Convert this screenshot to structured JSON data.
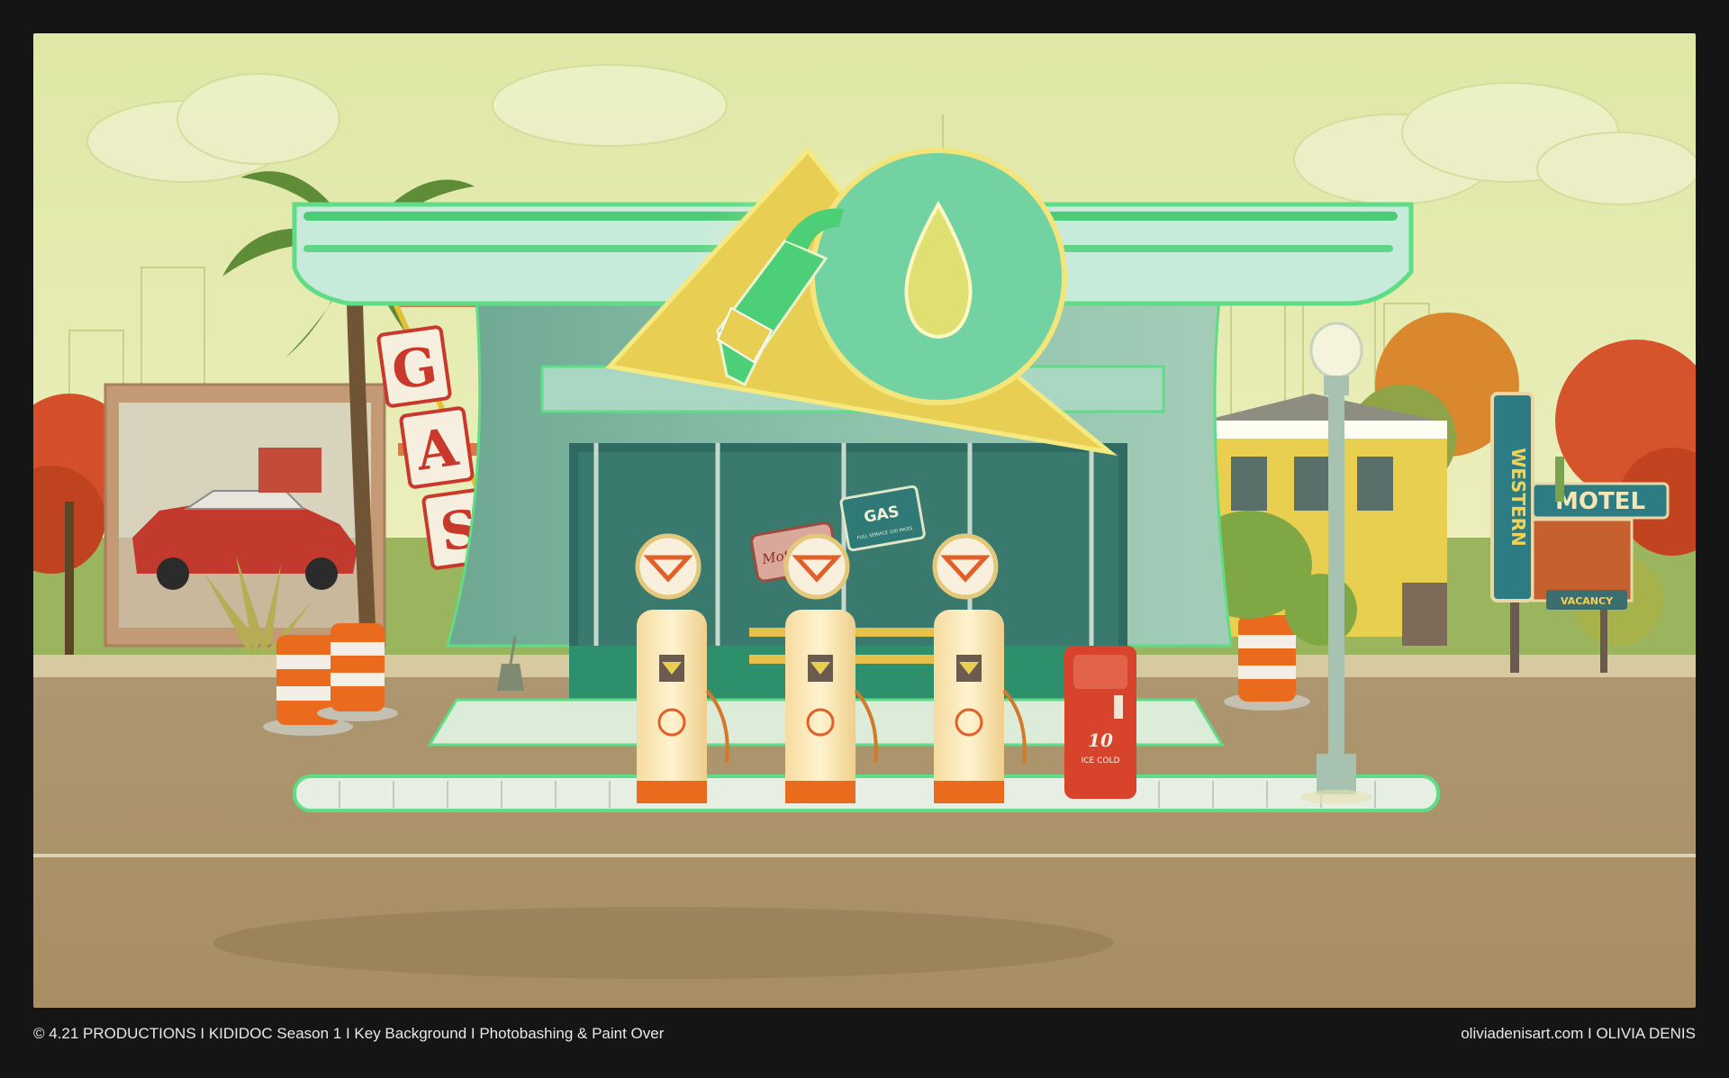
{
  "artwork": {
    "signs": {
      "gas_letters": [
        "G",
        "A",
        "S"
      ],
      "rooftop_sign": "GAS",
      "window_sign_1": "Motor Oil",
      "window_sign_2_title": "GAS",
      "window_sign_2_sub": "FULL SERVICE 100 MILES",
      "motel_vertical": "WESTERN",
      "motel_name": "MOTEL",
      "motel_vacancy": "VACANCY",
      "cooler_number": "10",
      "cooler_label": "ICE COLD"
    },
    "colors": {
      "sky": "#e6ecae",
      "neon_green": "#5fdc86",
      "building": "#7fb9a3",
      "road": "#b49c72",
      "sign_red": "#c8392b",
      "cone_orange": "#ea6a1e"
    }
  },
  "caption": {
    "left": "© 4.21 PRODUCTIONS  I  KIDIDOC Season 1  I  Key Background  I Photobashing & Paint Over",
    "right": "oliviadenisart.com  I  OLIVIA DENIS"
  }
}
